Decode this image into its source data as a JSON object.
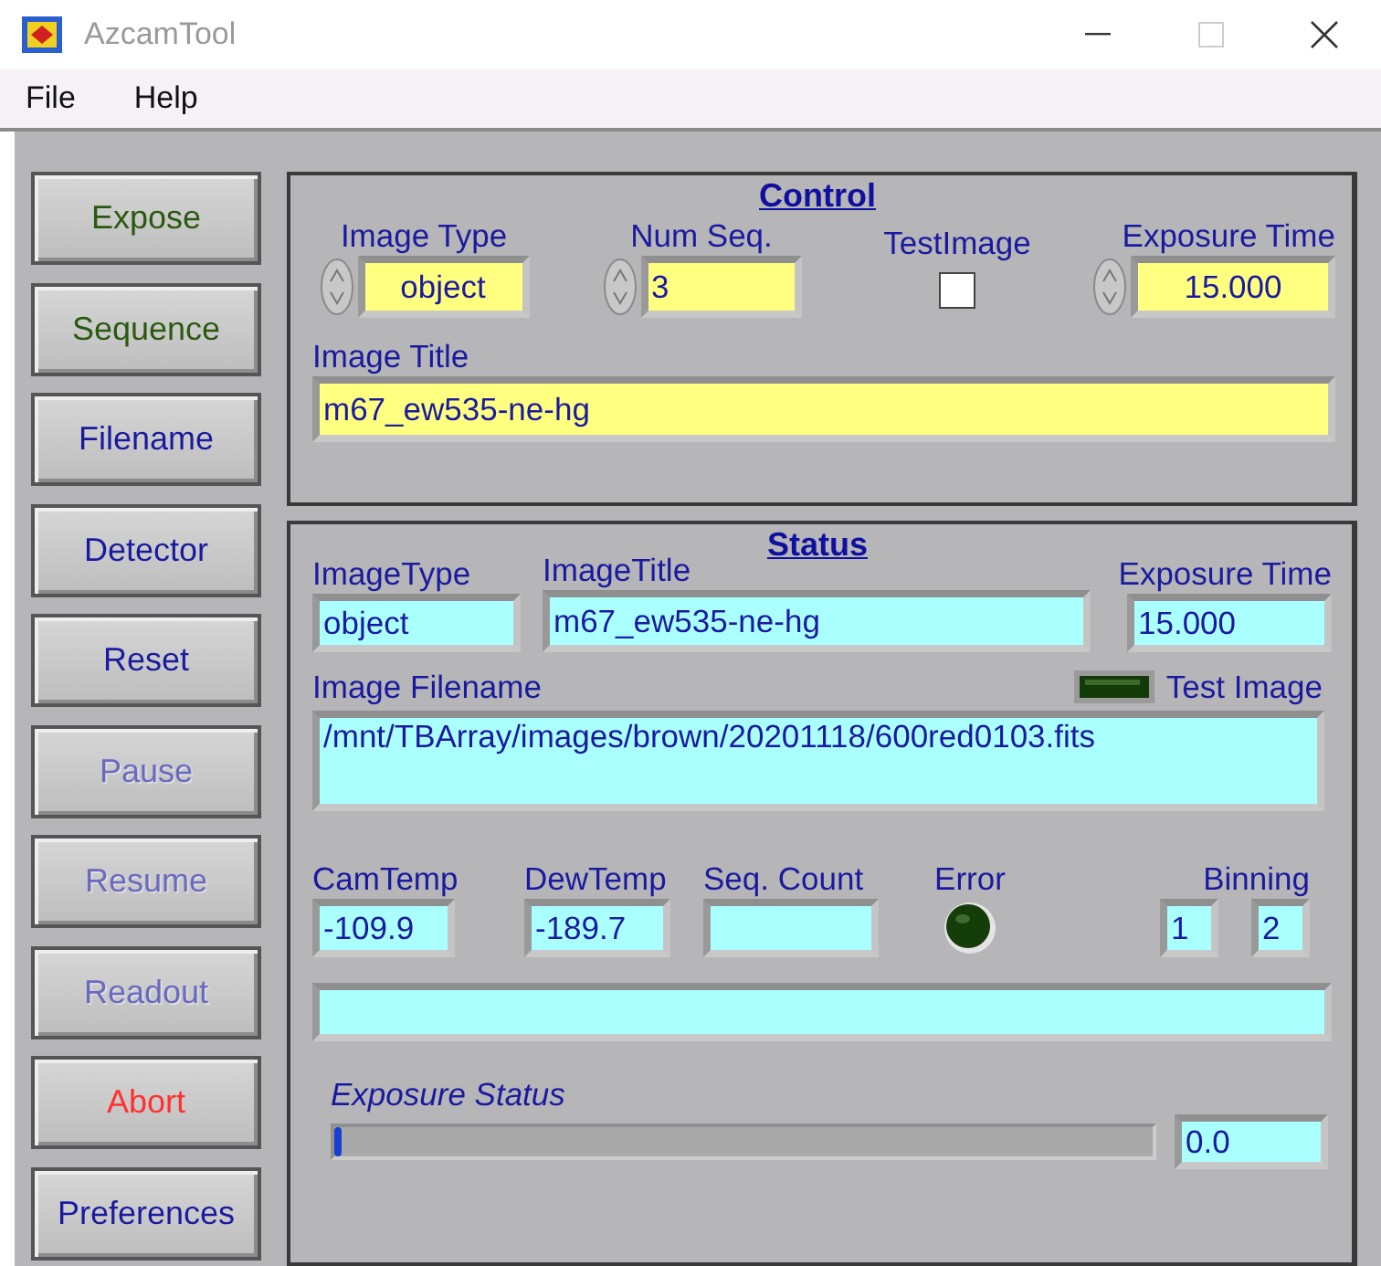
{
  "window": {
    "title": "AzcamTool"
  },
  "menu": [
    "File",
    "Help"
  ],
  "sidebar": [
    {
      "label": "Expose",
      "color": "#2a5a10",
      "disabled": false
    },
    {
      "label": "Sequence",
      "color": "#2a5a10",
      "disabled": false
    },
    {
      "label": "Filename",
      "color": "#1a1aa0",
      "disabled": false
    },
    {
      "label": "Detector",
      "color": "#1a1aa0",
      "disabled": false
    },
    {
      "label": "Reset",
      "color": "#1a1aa0",
      "disabled": false
    },
    {
      "label": "Pause",
      "color": "#6a6ac0",
      "disabled": true
    },
    {
      "label": "Resume",
      "color": "#6a6ac0",
      "disabled": true
    },
    {
      "label": "Readout",
      "color": "#6a6ac0",
      "disabled": true
    },
    {
      "label": "Abort",
      "color": "#ff3030",
      "disabled": false
    },
    {
      "label": "Preferences",
      "color": "#1a1aa0",
      "disabled": false
    }
  ],
  "control": {
    "title": "Control",
    "image_type": {
      "label": "Image Type",
      "value": "object"
    },
    "num_seq": {
      "label": "Num Seq.",
      "value": "3"
    },
    "test_image": {
      "label": "TestImage",
      "checked": false
    },
    "exposure_time": {
      "label": "Exposure Time",
      "value": "15.000"
    },
    "image_title": {
      "label": "Image Title",
      "value": "m67_ew535-ne-hg"
    }
  },
  "status": {
    "title": "Status",
    "image_type": {
      "label": "ImageType",
      "value": "object"
    },
    "image_title": {
      "label": "ImageTitle",
      "value": "m67_ew535-ne-hg"
    },
    "exposure_time": {
      "label": "Exposure Time",
      "value": "15.000"
    },
    "test_image": {
      "label": "Test Image",
      "on": false
    },
    "image_filename": {
      "label": "Image Filename",
      "value": "/mnt/TBArray/images/brown/20201118/600red0103.fits"
    },
    "cam_temp": {
      "label": "CamTemp",
      "value": "-109.9"
    },
    "dew_temp": {
      "label": "DewTemp",
      "value": "-189.7"
    },
    "seq_count": {
      "label": "Seq. Count"
    },
    "error": {
      "label": "Error",
      "on": false
    },
    "binning": {
      "label": "Binning",
      "values": [
        "1",
        "2"
      ]
    },
    "exposure_status": {
      "label": "Exposure Status",
      "level": 0.01,
      "value": "0.0"
    }
  }
}
